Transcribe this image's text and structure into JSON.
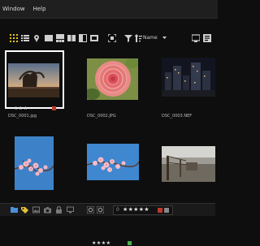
{
  "menu": {
    "items": [
      "Window",
      "Help"
    ]
  },
  "toolbar": {
    "sort_label": "Name"
  },
  "images": [
    {
      "filename": "DSC_0001.jpg",
      "stars": "★★★",
      "label_color": "#c0392b"
    },
    {
      "filename": "DSC_0002.JPG"
    },
    {
      "filename": "DSC_0003.NEF"
    },
    {
      "filename": ""
    },
    {
      "stars": "★★★★",
      "label_color": "#4caf50"
    },
    {
      "filename": ""
    }
  ],
  "statusbar": {
    "rating_zero": "0",
    "rating_stars": "★★★★★",
    "label_colors": [
      "#c0392b",
      "#888888"
    ]
  }
}
